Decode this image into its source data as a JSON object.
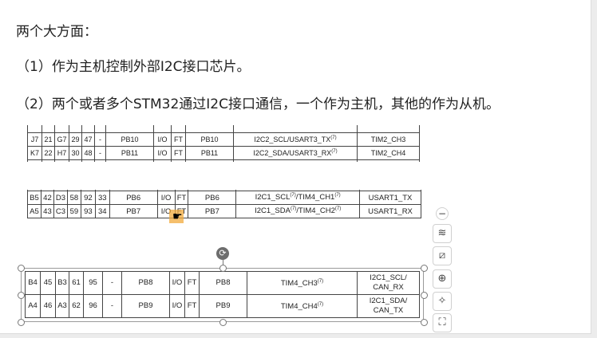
{
  "text": {
    "line1": "两个大方面：",
    "line2": "（1）作为主机控制外部I2C接口芯片。",
    "line3": "（2）两个或者多个STM32通过I2C接口通信，一个作为主机，其他的作为从机。"
  },
  "snippet1": {
    "rows": [
      {
        "c1": "J7",
        "c2": "21",
        "c3": "G7",
        "c4": "29",
        "c5": "47",
        "c6": "-",
        "c7": "PB10",
        "c8": "I/O",
        "c9": "FT",
        "c10": "PB10",
        "c11": "I2C2_SCL/USART3_TX",
        "sup11": "(7)",
        "c12": "TIM2_CH3"
      },
      {
        "c1": "K7",
        "c2": "22",
        "c3": "H7",
        "c4": "30",
        "c5": "48",
        "c6": "-",
        "c7": "PB11",
        "c8": "I/O",
        "c9": "FT",
        "c10": "PB11",
        "c11": "I2C2_SDA/USART3_RX",
        "sup11": "(7)",
        "c12": "TIM2_CH4"
      }
    ]
  },
  "snippet2": {
    "rows": [
      {
        "c1": "B5",
        "c2": "42",
        "c3": "D3",
        "c4": "58",
        "c5": "92",
        "c6": "33",
        "c7": "PB6",
        "c8": "I/O",
        "c9": "FT",
        "c10": "PB6",
        "c11a": "I2C1_SCL",
        "sup11a": "(7)",
        "c11b": "/TIM4_CH1",
        "sup11b": "(7)",
        "c12": "USART1_TX"
      },
      {
        "c1": "A5",
        "c2": "43",
        "c3": "C3",
        "c4": "59",
        "c5": "93",
        "c6": "34",
        "c7": "PB7",
        "c8": "I/O",
        "c9": "FT",
        "c10": "PB7",
        "c11a": "I2C1_SDA",
        "sup11a": "(7)",
        "c11b": "/TIM4_CH2",
        "sup11b": "(7)",
        "c12": "USART1_RX"
      }
    ]
  },
  "snippet3": {
    "rows": [
      {
        "c1": "B4",
        "c2": "45",
        "c3": "B3",
        "c4": "61",
        "c5": "95",
        "c6": "-",
        "c7": "PB8",
        "c8": "I/O",
        "c9": "FT",
        "c10": "PB8",
        "c11": "TIM4_CH3",
        "sup11": "(7)",
        "c12a": "I2C1_SCL/",
        "c12b": "CAN_RX"
      },
      {
        "c1": "A4",
        "c2": "46",
        "c3": "A3",
        "c4": "62",
        "c5": "96",
        "c6": "-",
        "c7": "PB9",
        "c8": "I/O",
        "c9": "FT",
        "c10": "PB9",
        "c11": "TIM4_CH4",
        "sup11": "(7)",
        "c12a": "I2C1_SDA/",
        "c12b": "CAN_TX"
      }
    ]
  },
  "toolbar": {
    "icons": [
      "minus-icon",
      "layers-icon",
      "crop-icon",
      "zoom-in-icon",
      "magic-wand-icon",
      "fit-screen-icon"
    ],
    "glyphs": [
      "−",
      "≋",
      "⧄",
      "⊕",
      "✧",
      "⛶"
    ]
  },
  "selection": {
    "rotate_glyph": "⟳"
  },
  "cursor": {
    "glyph": "☛"
  }
}
